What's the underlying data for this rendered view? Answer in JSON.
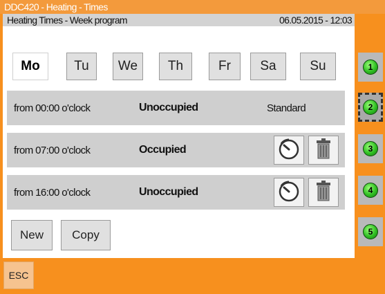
{
  "window": {
    "title": "DDC420 - Heating - Times"
  },
  "header": {
    "title": "Heating Times - Week program",
    "datetime": "06.05.2015 - 12:03"
  },
  "days": [
    {
      "label": "Mo",
      "active": true
    },
    {
      "label": "Tu",
      "active": false
    },
    {
      "label": "We",
      "active": false
    },
    {
      "label": "Th",
      "active": false
    },
    {
      "label": "Fr",
      "active": false
    },
    {
      "label": "Sa",
      "active": false
    },
    {
      "label": "Su",
      "active": false
    }
  ],
  "schedule": [
    {
      "from": "from 00:00 o'clock",
      "state": "Unoccupied",
      "profile": "Standard"
    },
    {
      "from": "from 07:00 o'clock",
      "state": "Occupied"
    },
    {
      "from": "from 16:00 o'clock",
      "state": "Unoccupied"
    }
  ],
  "actions": {
    "new_label": "New",
    "copy_label": "Copy"
  },
  "side_buttons": [
    "1",
    "2",
    "3",
    "4",
    "5"
  ],
  "footer": {
    "esc_label": "ESC"
  },
  "icons": {
    "edit": "dial-icon",
    "delete": "trash-icon"
  },
  "colors": {
    "accent": "#f7901e",
    "led": "#2fbf22"
  }
}
